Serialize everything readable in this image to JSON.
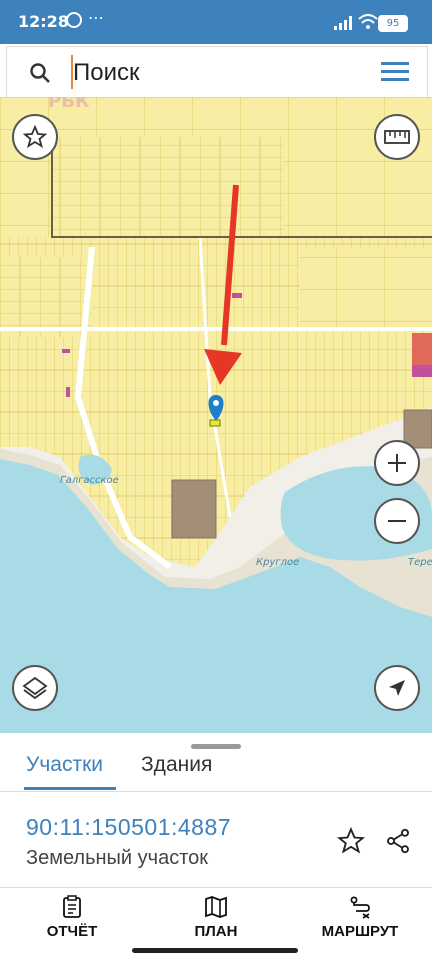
{
  "status_bar": {
    "time": "12:28",
    "battery": "95"
  },
  "search": {
    "placeholder": "Поиск"
  },
  "map": {
    "place_labels": [
      "Галгасское",
      "Круглое",
      "Тере"
    ],
    "watermark": "РБК"
  },
  "tabs": [
    {
      "label": "Участки",
      "active": true
    },
    {
      "label": "Здания",
      "active": false
    }
  ],
  "parcel": {
    "cadastral_number": "90:11:150501:4887",
    "type": "Земельный участок"
  },
  "actions": [
    {
      "label": "ОТЧЁТ",
      "icon": "report-icon"
    },
    {
      "label": "ПЛАН",
      "icon": "map-plan-icon"
    },
    {
      "label": "МАРШРУТ",
      "icon": "route-icon"
    }
  ],
  "colors": {
    "accent": "#3d82bd",
    "parcel_fill": "#f7eda3",
    "parcel_stroke": "#dcc55a",
    "sea": "#a8dbe6",
    "arrow": "#e53626"
  }
}
